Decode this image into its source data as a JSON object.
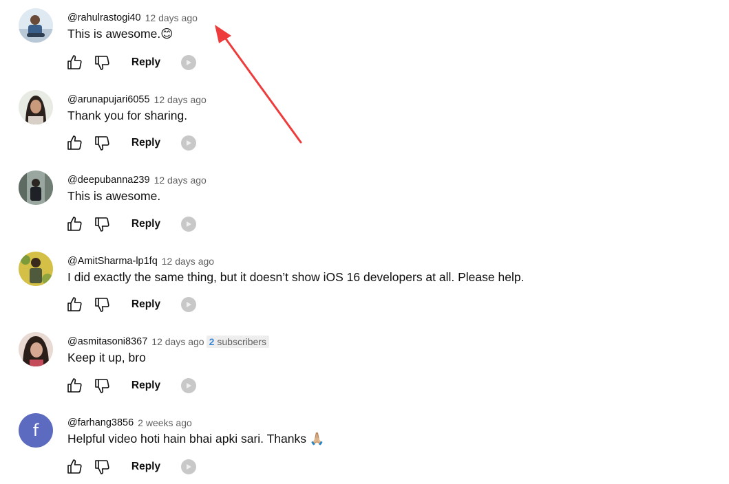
{
  "ui": {
    "reply_label": "Reply",
    "icons": {
      "like": "thumbs-up-icon",
      "dislike": "thumbs-down-icon",
      "extra": "grey-circle-icon"
    },
    "annotation_arrow_color": "#ee3b3b"
  },
  "comments": [
    {
      "author": "@rahulrastogi40",
      "time": "12 days ago",
      "text": "This is awesome.😊",
      "avatar": "photo"
    },
    {
      "author": "@arunapujari6055",
      "time": "12 days ago",
      "text": "Thank you for sharing.",
      "avatar": "photo"
    },
    {
      "author": "@deepubanna239",
      "time": "12 days ago",
      "text": "This is awesome.",
      "avatar": "photo"
    },
    {
      "author": "@AmitSharma-lp1fq",
      "time": "12 days ago",
      "text": "I did exactly the same thing, but it doesn’t show iOS 16 developers at all. Please help.",
      "avatar": "photo"
    },
    {
      "author": "@asmitasoni8367",
      "time": "12 days ago",
      "text": "Keep it up, bro",
      "avatar": "photo",
      "badge_count": "2",
      "badge_label": "subscribers"
    },
    {
      "author": "@farhang3856",
      "time": "2 weeks ago",
      "text": "Helpful video hoti hain bhai apki sari. Thanks 🙏🏼",
      "avatar": "letter",
      "avatar_letter": "f",
      "avatar_color": "#5c6bc0"
    }
  ]
}
